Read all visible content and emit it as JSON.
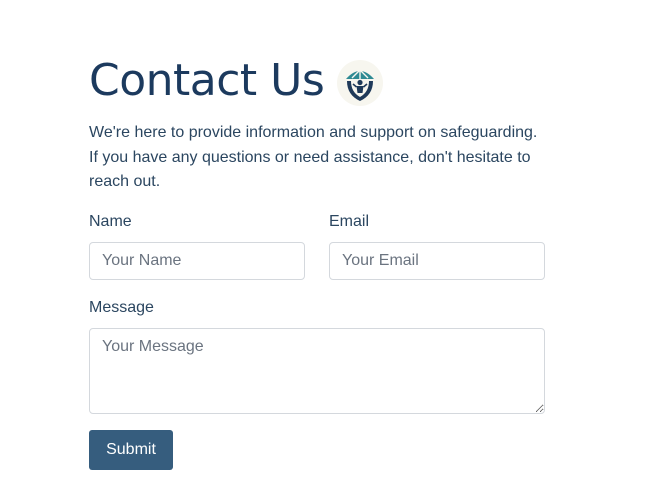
{
  "header": {
    "title": "Contact Us",
    "logo_icon": "shield-person-icon"
  },
  "intro_text": "We're here to provide information and support on safeguarding. If you have any questions or need assistance, don't hesitate to reach out.",
  "form": {
    "name_label": "Name",
    "name_placeholder": "Your Name",
    "email_label": "Email",
    "email_placeholder": "Your Email",
    "message_label": "Message",
    "message_placeholder": "Your Message",
    "submit_label": "Submit"
  },
  "colors": {
    "heading": "#1c3a5e",
    "button": "#365d7e",
    "logo_teal": "#2e8a93",
    "logo_dark": "#1f3a5a"
  }
}
